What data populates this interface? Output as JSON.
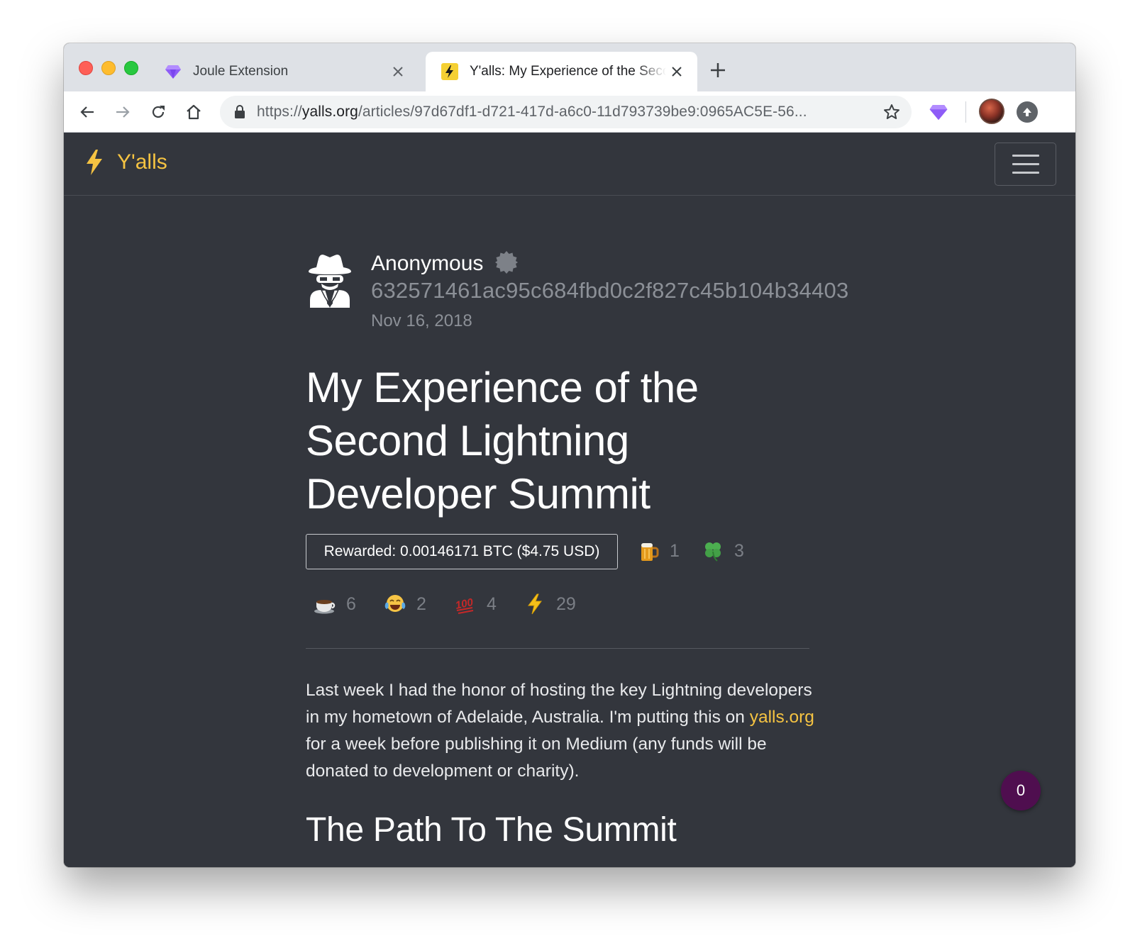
{
  "browser": {
    "tabs": [
      {
        "title": "Joule Extension",
        "active": false,
        "icon": "gem-icon"
      },
      {
        "title": "Y'alls: My Experience of the Second Lightning Developer Summit",
        "active": true,
        "icon": "lightning-icon"
      }
    ],
    "url": {
      "scheme": "https://",
      "host": "yalls.org",
      "path": "/articles/97d67df1-d721-417d-a6c0-11d793739be9:0965AC5E-56..."
    }
  },
  "site": {
    "brand": "Y'alls",
    "brand_color": "#f5c342",
    "menu_icon": "hamburger-icon"
  },
  "article": {
    "author_name": "Anonymous",
    "author_id": "632571461ac95c684fbd0c2f827c45b104b34403",
    "date": "Nov 16, 2018",
    "title": "My Experience of the Second Lightning Developer Summit",
    "reward": "Rewarded: 0.00146171 BTC ($4.75 USD)",
    "reactions": [
      {
        "emoji": "beer",
        "count": "1"
      },
      {
        "emoji": "four-leaf-clover",
        "count": "3"
      },
      {
        "emoji": "coffee",
        "count": "6"
      },
      {
        "emoji": "tears-of-joy",
        "count": "2"
      },
      {
        "emoji": "hundred",
        "count": "4"
      },
      {
        "emoji": "high-voltage",
        "count": "29"
      }
    ],
    "intro_part1": "Last week I had the honor of hosting the key Lightning developers in my hometown of Adelaide, Australia. I'm putting this on ",
    "intro_link": "yalls.org",
    "intro_part2": " for a week before publishing it on Medium (any funds will be donated to development or charity).",
    "section_heading": "The Path To The Summit"
  },
  "tip_count": "0"
}
